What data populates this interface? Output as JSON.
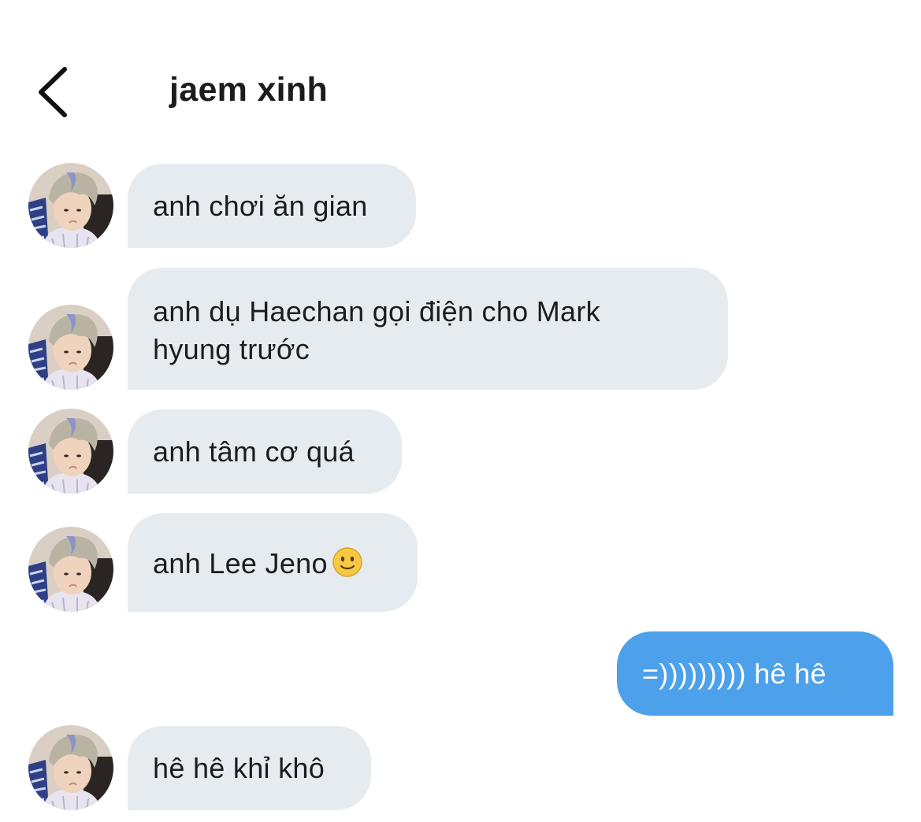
{
  "header": {
    "back_icon": "chevron-left-icon",
    "title": "jaem xinh"
  },
  "messages": [
    {
      "direction": "incoming",
      "text": "anh chơi ăn gian"
    },
    {
      "direction": "incoming",
      "text": "anh dụ Haechan gọi điện cho Mark hyung trước"
    },
    {
      "direction": "incoming",
      "text": "anh tâm cơ quá"
    },
    {
      "direction": "incoming",
      "text": "anh Lee Jeno",
      "emoji": "slightly-smiling-face-emoji"
    },
    {
      "direction": "outgoing",
      "text": "=))))))))) hê hê"
    },
    {
      "direction": "incoming",
      "text": "hê hê khỉ khô"
    }
  ],
  "colors": {
    "incoming_bubble": "#e6ebf0",
    "outgoing_bubble": "#4da1ea",
    "incoming_text": "#1c1c1e",
    "outgoing_text": "#ffffff",
    "background": "#ffffff"
  }
}
